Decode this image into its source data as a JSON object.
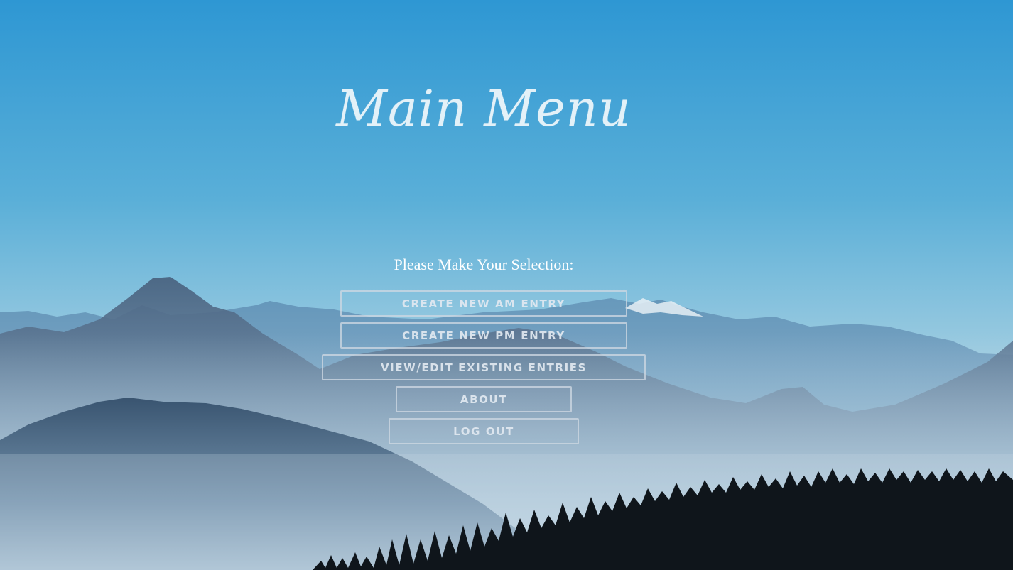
{
  "page": {
    "title": "Main Menu",
    "prompt": "Please Make Your Selection:"
  },
  "menu": {
    "buttons": [
      {
        "id": "create-am",
        "label": "CREATE NEW AM ENTRY"
      },
      {
        "id": "create-pm",
        "label": "CREATE NEW PM ENTRY"
      },
      {
        "id": "view-edit",
        "label": "VIEW/EDIT EXISTING ENTRIES"
      },
      {
        "id": "about",
        "label": "ABOUT"
      },
      {
        "id": "log-out",
        "label": "LOG OUT"
      }
    ]
  },
  "theme": {
    "sky_top": "#2f98d4",
    "sky_bottom": "#a9cfe0",
    "mountain_dark": "#3f5872",
    "mist": "#c9dbe6",
    "trees": "#10161c",
    "button_border": "#cdd7e1",
    "button_text": "#e1e8f0",
    "title_color": "#e3f1f8"
  }
}
